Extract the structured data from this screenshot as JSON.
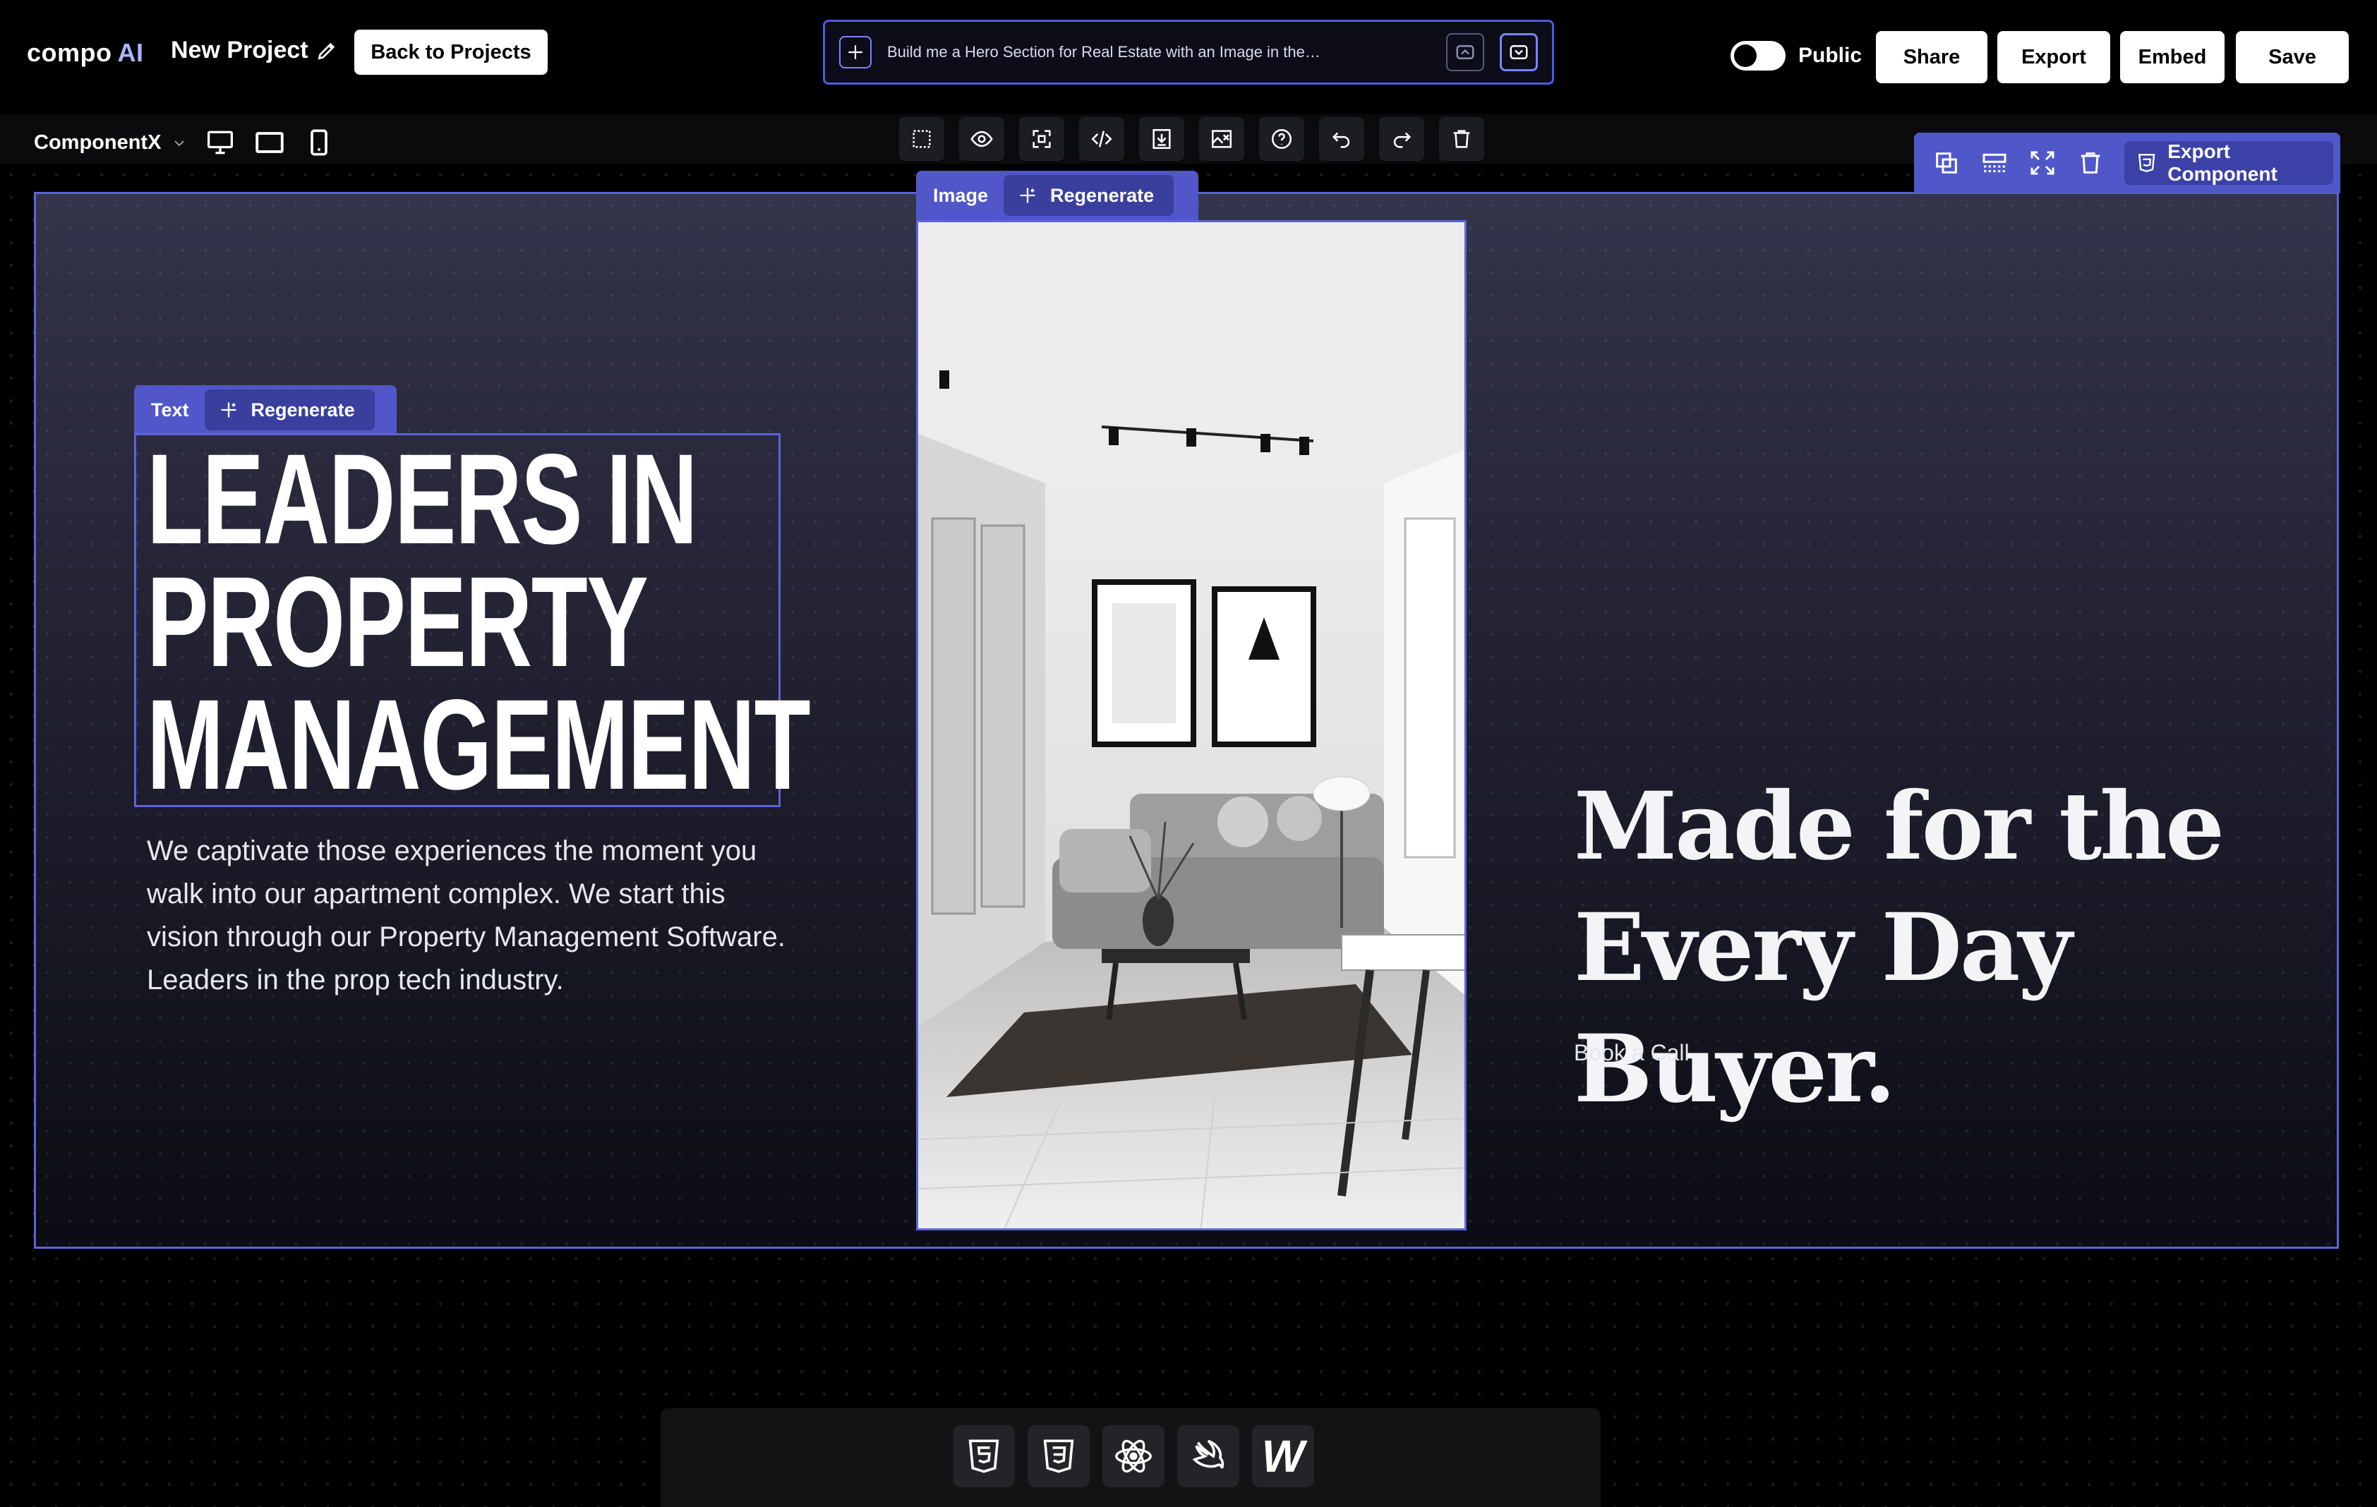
{
  "header": {
    "logo_main": "compo",
    "logo_ai": "AI",
    "project_title": "New Project",
    "back_label": "Back to Projects",
    "prompt": "Build me a Hero Section for Real Estate with an Image in the…",
    "public_label": "Public",
    "share_label": "Share",
    "export_label": "Export",
    "embed_label": "Embed",
    "save_label": "Save"
  },
  "toolbar": {
    "component_name": "ComponentX",
    "device_icons": [
      "desktop-icon",
      "tablet-icon",
      "mobile-icon"
    ],
    "tools": [
      "select-icon",
      "preview-eye-icon",
      "resize-icon",
      "code-icon",
      "download-icon",
      "image-edit-icon",
      "help-icon",
      "undo-icon",
      "redo-icon",
      "trash-icon"
    ]
  },
  "component_panel": {
    "export_component_label": "Export Component"
  },
  "text_block": {
    "tag": "Text",
    "regenerate": "Regenerate",
    "headline": "LEADERS IN\nPROPERTY\nMANAGEMENT",
    "paragraph": "We captivate those experiences the moment you walk into our apartment complex. We start this vision through our Property Management Software. Leaders in the prop tech industry."
  },
  "image_block": {
    "tag": "Image",
    "regenerate": "Regenerate"
  },
  "right_block": {
    "headline": "Made for the\nEvery Day Buyer.",
    "cta": "Book a Call"
  },
  "dock": {
    "icons": [
      "html5-icon",
      "css3-icon",
      "react-icon",
      "swift-icon",
      "webflow-icon"
    ],
    "webflow_letter": "W"
  },
  "colors": {
    "accent": "#5c64d8",
    "tab": "#5157c8",
    "tab_dark": "#3a3f9e"
  }
}
